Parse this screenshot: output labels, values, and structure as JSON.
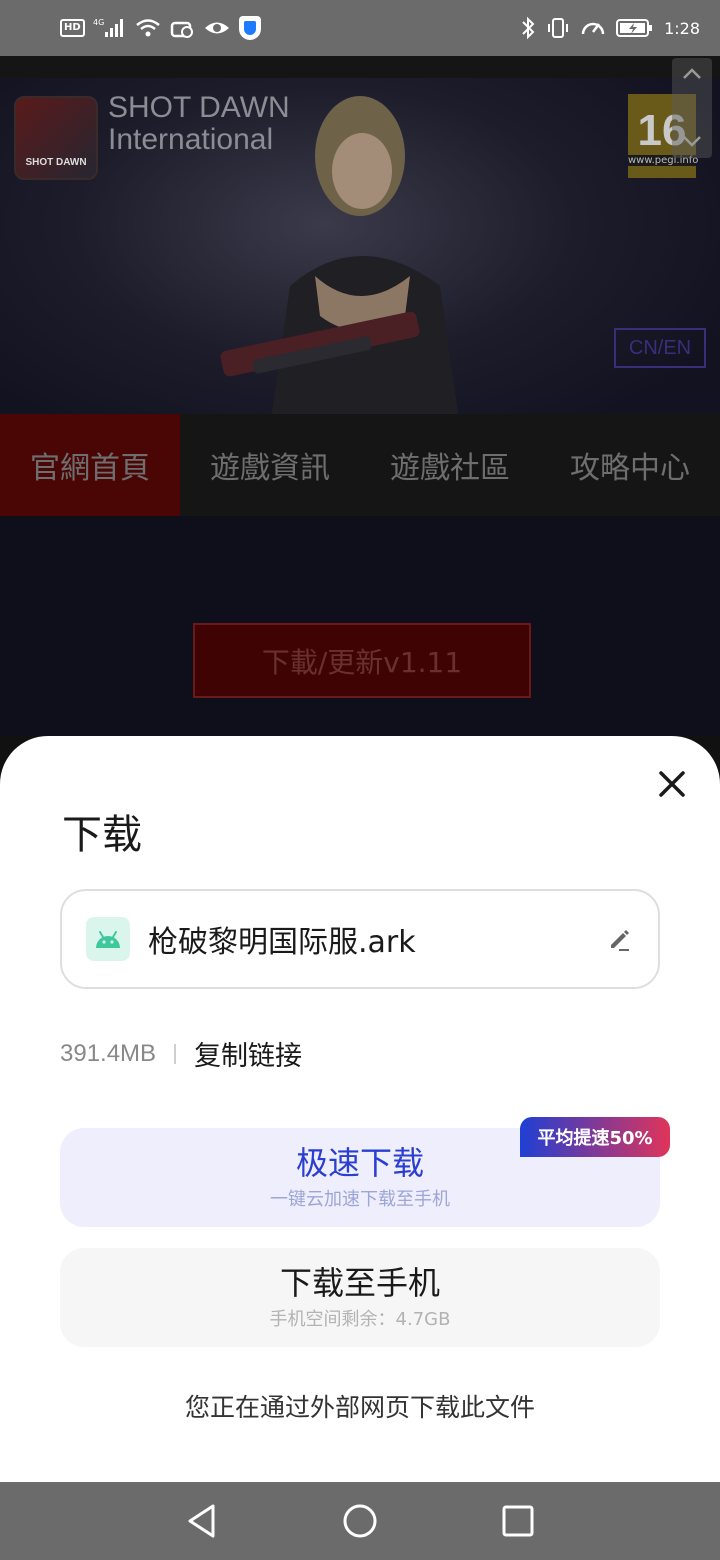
{
  "status_bar": {
    "hd": "HD",
    "network": "4G",
    "time": "1:28",
    "icons_left": [
      "hd-icon",
      "signal-icon",
      "wifi-icon",
      "cloud-icon",
      "eye-icon",
      "shield-icon"
    ],
    "icons_right": [
      "bluetooth-icon",
      "vibrate-icon",
      "speed-icon",
      "battery-icon"
    ]
  },
  "webpage": {
    "logo_text": "SHOT DAWN",
    "title_line1": "SHOT DAWN",
    "title_line2": "International",
    "pegi_rating": "16",
    "pegi_site": "www.pegi.info",
    "lang_toggle": "CN/EN",
    "nav": [
      "官網首頁",
      "遊戲資訊",
      "遊戲社區",
      "攻略中心"
    ],
    "download_button": "下載/更新v1.11"
  },
  "sheet": {
    "title": "下载",
    "file_name": "枪破黎明国际服.ark",
    "file_size": "391.4MB",
    "copy_link": "复制链接",
    "fast_download": {
      "label": "极速下载",
      "sub": "一键云加速下载至手机",
      "badge": "平均提速50%"
    },
    "phone_download": {
      "label": "下载至手机",
      "sub": "手机空间剩余：4.7GB"
    },
    "notice": "您正在通过外部网页下载此文件"
  },
  "colors": {
    "accent_blue": "#2a3fcf",
    "badge_gradient_start": "#1f3fd4",
    "badge_gradient_end": "#e0345a",
    "apk_green": "#3ec99c"
  }
}
